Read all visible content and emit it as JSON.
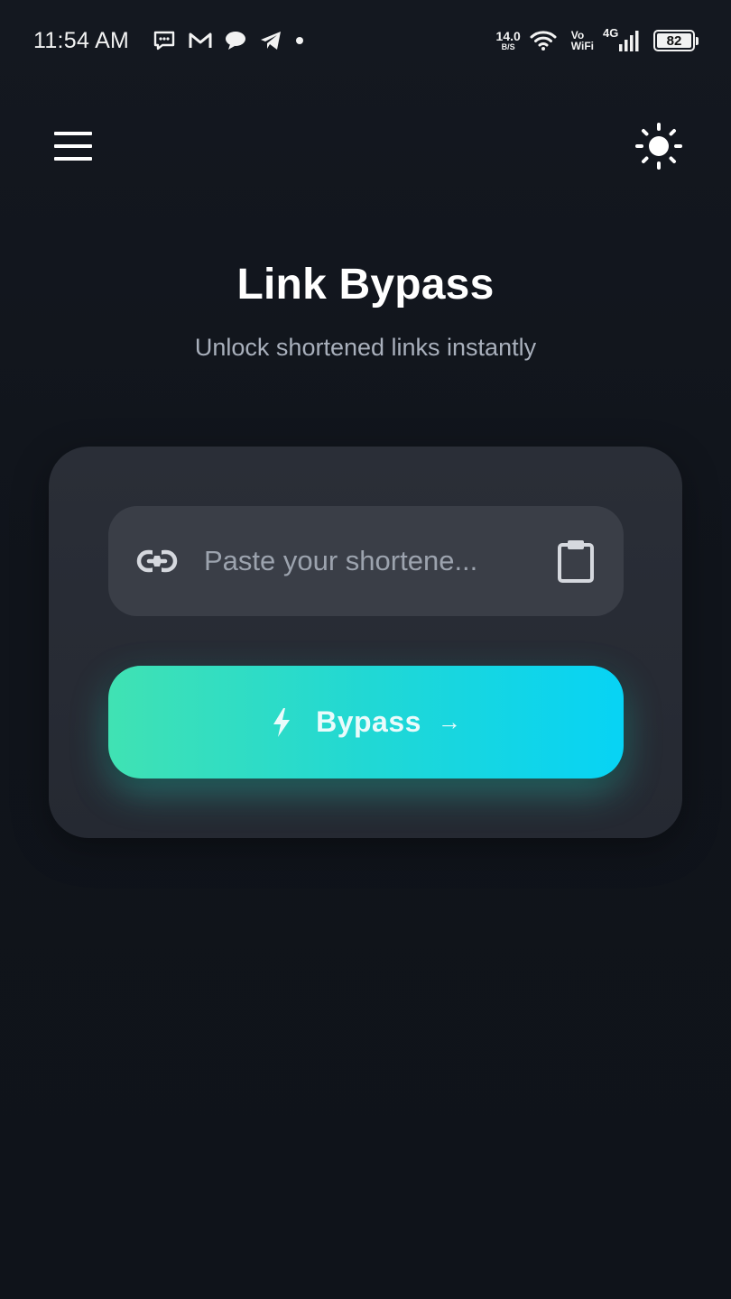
{
  "status_bar": {
    "time": "11:54 AM",
    "notification_icons": [
      "chat-icon",
      "gmail-icon",
      "message-icon",
      "telegram-icon",
      "dot-icon"
    ],
    "net_speed_value": "14.0",
    "net_speed_unit": "B/S",
    "vowifi_line1": "Vo",
    "vowifi_line2": "WiFi",
    "network_type": "4G",
    "battery_level": "82"
  },
  "app_bar": {
    "menu_icon": "hamburger-menu-icon",
    "theme_icon": "sun-icon"
  },
  "header": {
    "title": "Link Bypass",
    "subtitle": "Unlock shortened links instantly"
  },
  "form": {
    "input_placeholder": "Paste your shortene...",
    "input_value": "",
    "link_icon": "link-icon",
    "paste_icon": "clipboard-icon",
    "button_label": "Bypass",
    "button_arrow": "→",
    "button_icon": "lightning-bolt-icon"
  },
  "colors": {
    "background": "#10141b",
    "card": "#282c35",
    "input": "#3a3e47",
    "accent_start": "#40e2b3",
    "accent_end": "#07d3f5",
    "subtitle": "#a9b0bc"
  }
}
